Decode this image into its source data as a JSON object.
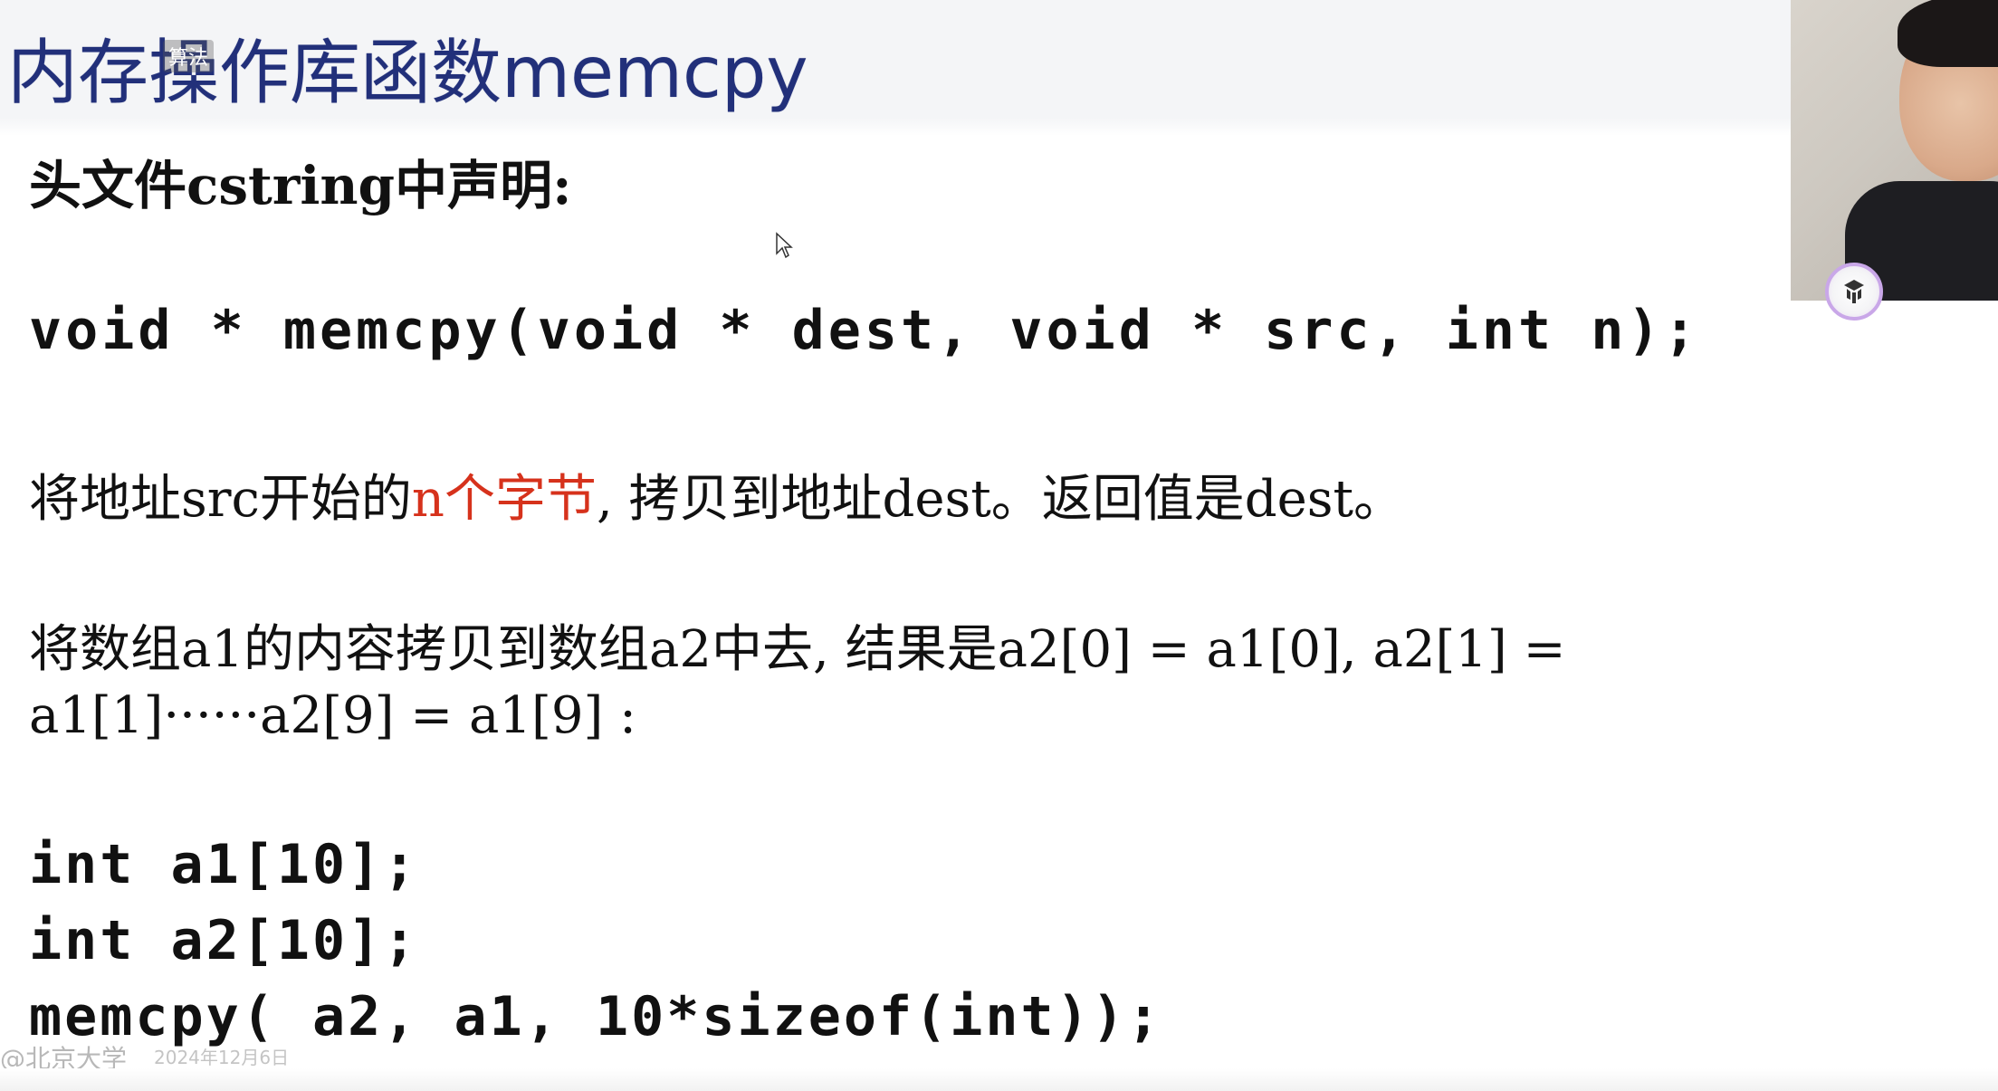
{
  "slide": {
    "title": "内存操作库函数memcpy",
    "owner_tag": "算法",
    "header_line": "头文件cstring中声明:",
    "prototype": "void * memcpy(void * dest, void * src, int n);",
    "desc": {
      "part1": "将地址src开始的",
      "highlight": "n个字节",
      "part2": ", 拷贝到地址dest。返回值是dest。"
    },
    "desc2": "将数组a1的内容拷贝到数组a2中去, 结果是a2[0] = a1[0], a2[1] =",
    "desc3": "a1[1]······a2[9] = a1[9] :",
    "code": [
      "int a1[10];",
      "int a2[10];",
      "memcpy( a2, a1, 10*sizeof(int));"
    ]
  },
  "footer": {
    "watermark": "@北京大学",
    "date": "2024年12月6日"
  },
  "colors": {
    "title": "#22307a",
    "highlight": "#d6321c",
    "text": "#111111"
  },
  "icons": {
    "cursor": "mouse-pointer-icon",
    "cam_logo": "platform-logo-icon"
  }
}
